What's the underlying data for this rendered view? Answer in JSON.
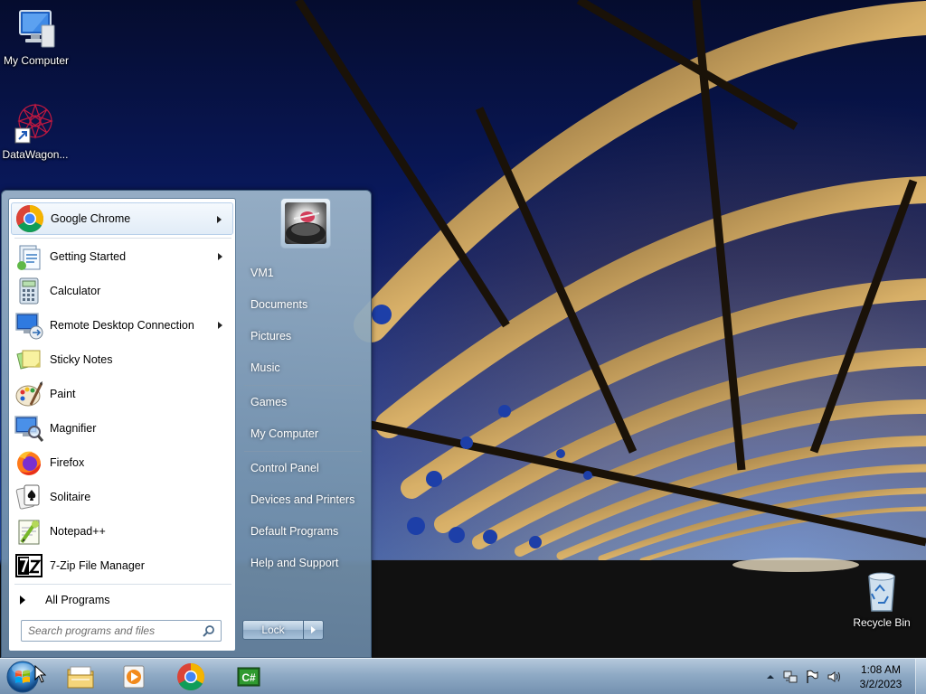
{
  "desktop": {
    "icons": [
      {
        "label": "My Computer"
      },
      {
        "label": "DataWagon..."
      },
      {
        "label": "Recycle Bin"
      }
    ]
  },
  "start_menu": {
    "programs": [
      {
        "label": "Google Chrome",
        "icon": "chrome-icon",
        "has_submenu": true
      },
      {
        "label": "Getting Started",
        "icon": "getting-started-icon",
        "has_submenu": true
      },
      {
        "label": "Calculator",
        "icon": "calculator-icon",
        "has_submenu": false
      },
      {
        "label": "Remote Desktop Connection",
        "icon": "remote-desktop-icon",
        "has_submenu": true
      },
      {
        "label": "Sticky Notes",
        "icon": "sticky-notes-icon",
        "has_submenu": false
      },
      {
        "label": "Paint",
        "icon": "paint-icon",
        "has_submenu": false
      },
      {
        "label": "Magnifier",
        "icon": "magnifier-icon",
        "has_submenu": false
      },
      {
        "label": "Firefox",
        "icon": "firefox-icon",
        "has_submenu": false
      },
      {
        "label": "Solitaire",
        "icon": "solitaire-icon",
        "has_submenu": false
      },
      {
        "label": "Notepad++",
        "icon": "notepadpp-icon",
        "has_submenu": false
      },
      {
        "label": "7-Zip File Manager",
        "icon": "7zip-icon",
        "has_submenu": false
      }
    ],
    "all_programs": "All Programs",
    "search_placeholder": "Search programs and files",
    "right_links": {
      "user": "VM1",
      "documents": "Documents",
      "pictures": "Pictures",
      "music": "Music",
      "games": "Games",
      "my_computer": "My Computer",
      "control_panel": "Control Panel",
      "devices_printers": "Devices and Printers",
      "default_programs": "Default Programs",
      "help_support": "Help and Support"
    },
    "lock_label": "Lock"
  },
  "taskbar": {
    "pinned": [
      "file-explorer-icon",
      "media-player-icon",
      "chrome-icon",
      "csharp-ide-icon"
    ],
    "clock": {
      "time": "1:08 AM",
      "date": "3/2/2023"
    }
  },
  "colors": {
    "accent": "#2b5ec9",
    "highlight_border": "#b8d0ea"
  }
}
